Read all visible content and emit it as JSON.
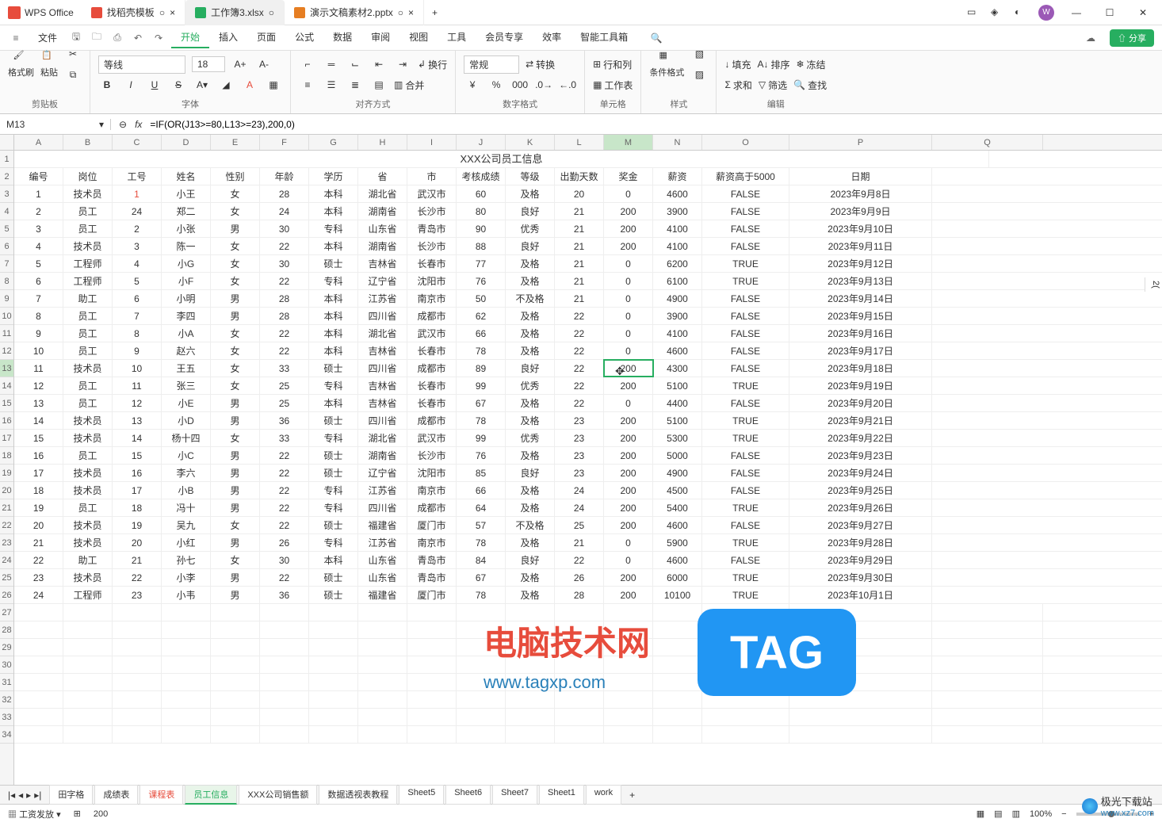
{
  "app": {
    "name": "WPS Office"
  },
  "tabs": [
    {
      "label": "找稻壳模板",
      "icon": "red"
    },
    {
      "label": "工作簿3.xlsx",
      "icon": "green",
      "active": true
    },
    {
      "label": "演示文稿素材2.pptx",
      "icon": "orange"
    }
  ],
  "window_controls": {
    "min": "—",
    "max": "☐",
    "close": "✕"
  },
  "avatar_initial": "W",
  "menubar": {
    "file": "文件",
    "items": [
      "开始",
      "插入",
      "页面",
      "公式",
      "数据",
      "审阅",
      "视图",
      "工具",
      "会员专享",
      "效率",
      "智能工具箱"
    ],
    "active_index": 0,
    "share": "分享"
  },
  "ribbon": {
    "clipboard": {
      "format_painter": "格式刷",
      "paste": "粘贴",
      "label": "剪贴板"
    },
    "font": {
      "name": "等线",
      "size": "18",
      "inc": "A+",
      "dec": "A-",
      "bold": "B",
      "italic": "I",
      "underline": "U",
      "strike": "S",
      "label": "字体"
    },
    "align": {
      "wrap": "换行",
      "merge": "合并",
      "label": "对齐方式"
    },
    "number": {
      "format": "常规",
      "convert": "转换",
      "label": "数字格式"
    },
    "rowcol": {
      "rows": "行和列",
      "sheet": "工作表",
      "label": "单元格"
    },
    "style": {
      "cond": "条件格式",
      "label": "样式"
    },
    "edit": {
      "fill": "填充",
      "sum": "求和",
      "sort": "排序",
      "filter": "筛选",
      "freeze": "冻结",
      "find": "查找",
      "label": "编辑"
    }
  },
  "formula_bar": {
    "cell_ref": "M13",
    "fx": "fx",
    "formula": "=IF(OR(J13>=80,L13>=23),200,0)"
  },
  "columns": [
    "A",
    "B",
    "C",
    "D",
    "E",
    "F",
    "G",
    "H",
    "I",
    "J",
    "K",
    "L",
    "M",
    "N",
    "O",
    "P",
    "Q"
  ],
  "col_widths": [
    "cA",
    "cB",
    "cC",
    "cD",
    "cE",
    "cF",
    "cG",
    "cH",
    "cI",
    "cJ",
    "cK",
    "cL",
    "cM",
    "cN",
    "cO",
    "cP",
    "cQ"
  ],
  "sheet_title": "XXX公司员工信息",
  "headers": [
    "编号",
    "岗位",
    "工号",
    "姓名",
    "性别",
    "年龄",
    "学历",
    "省",
    "市",
    "考核成绩",
    "等级",
    "出勤天数",
    "奖金",
    "薪资",
    "薪资高于5000",
    "日期"
  ],
  "rows": [
    [
      "1",
      "技术员",
      "1",
      "小王",
      "女",
      "28",
      "本科",
      "湖北省",
      "武汉市",
      "60",
      "及格",
      "20",
      "0",
      "4600",
      "FALSE",
      "2023年9月8日"
    ],
    [
      "2",
      "员工",
      "24",
      "郑二",
      "女",
      "24",
      "本科",
      "湖南省",
      "长沙市",
      "80",
      "良好",
      "21",
      "200",
      "3900",
      "FALSE",
      "2023年9月9日"
    ],
    [
      "3",
      "员工",
      "2",
      "小张",
      "男",
      "30",
      "专科",
      "山东省",
      "青岛市",
      "90",
      "优秀",
      "21",
      "200",
      "4100",
      "FALSE",
      "2023年9月10日"
    ],
    [
      "4",
      "技术员",
      "3",
      "陈一",
      "女",
      "22",
      "本科",
      "湖南省",
      "长沙市",
      "88",
      "良好",
      "21",
      "200",
      "4100",
      "FALSE",
      "2023年9月11日"
    ],
    [
      "5",
      "工程师",
      "4",
      "小G",
      "女",
      "30",
      "硕士",
      "吉林省",
      "长春市",
      "77",
      "及格",
      "21",
      "0",
      "6200",
      "TRUE",
      "2023年9月12日"
    ],
    [
      "6",
      "工程师",
      "5",
      "小F",
      "女",
      "22",
      "专科",
      "辽宁省",
      "沈阳市",
      "76",
      "及格",
      "21",
      "0",
      "6100",
      "TRUE",
      "2023年9月13日"
    ],
    [
      "7",
      "助工",
      "6",
      "小明",
      "男",
      "28",
      "本科",
      "江苏省",
      "南京市",
      "50",
      "不及格",
      "21",
      "0",
      "4900",
      "FALSE",
      "2023年9月14日"
    ],
    [
      "8",
      "员工",
      "7",
      "李四",
      "男",
      "28",
      "本科",
      "四川省",
      "成都市",
      "62",
      "及格",
      "22",
      "0",
      "3900",
      "FALSE",
      "2023年9月15日"
    ],
    [
      "9",
      "员工",
      "8",
      "小A",
      "女",
      "22",
      "本科",
      "湖北省",
      "武汉市",
      "66",
      "及格",
      "22",
      "0",
      "4100",
      "FALSE",
      "2023年9月16日"
    ],
    [
      "10",
      "员工",
      "9",
      "赵六",
      "女",
      "22",
      "本科",
      "吉林省",
      "长春市",
      "78",
      "及格",
      "22",
      "0",
      "4600",
      "FALSE",
      "2023年9月17日"
    ],
    [
      "11",
      "技术员",
      "10",
      "王五",
      "女",
      "33",
      "硕士",
      "四川省",
      "成都市",
      "89",
      "良好",
      "22",
      "200",
      "4300",
      "FALSE",
      "2023年9月18日"
    ],
    [
      "12",
      "员工",
      "11",
      "张三",
      "女",
      "25",
      "专科",
      "吉林省",
      "长春市",
      "99",
      "优秀",
      "22",
      "200",
      "5100",
      "TRUE",
      "2023年9月19日"
    ],
    [
      "13",
      "员工",
      "12",
      "小E",
      "男",
      "25",
      "本科",
      "吉林省",
      "长春市",
      "67",
      "及格",
      "22",
      "0",
      "4400",
      "FALSE",
      "2023年9月20日"
    ],
    [
      "14",
      "技术员",
      "13",
      "小D",
      "男",
      "36",
      "硕士",
      "四川省",
      "成都市",
      "78",
      "及格",
      "23",
      "200",
      "5100",
      "TRUE",
      "2023年9月21日"
    ],
    [
      "15",
      "技术员",
      "14",
      "杨十四",
      "女",
      "33",
      "专科",
      "湖北省",
      "武汉市",
      "99",
      "优秀",
      "23",
      "200",
      "5300",
      "TRUE",
      "2023年9月22日"
    ],
    [
      "16",
      "员工",
      "15",
      "小C",
      "男",
      "22",
      "硕士",
      "湖南省",
      "长沙市",
      "76",
      "及格",
      "23",
      "200",
      "5000",
      "FALSE",
      "2023年9月23日"
    ],
    [
      "17",
      "技术员",
      "16",
      "李六",
      "男",
      "22",
      "硕士",
      "辽宁省",
      "沈阳市",
      "85",
      "良好",
      "23",
      "200",
      "4900",
      "FALSE",
      "2023年9月24日"
    ],
    [
      "18",
      "技术员",
      "17",
      "小B",
      "男",
      "22",
      "专科",
      "江苏省",
      "南京市",
      "66",
      "及格",
      "24",
      "200",
      "4500",
      "FALSE",
      "2023年9月25日"
    ],
    [
      "19",
      "员工",
      "18",
      "冯十",
      "男",
      "22",
      "专科",
      "四川省",
      "成都市",
      "64",
      "及格",
      "24",
      "200",
      "5400",
      "TRUE",
      "2023年9月26日"
    ],
    [
      "20",
      "技术员",
      "19",
      "吴九",
      "女",
      "22",
      "硕士",
      "福建省",
      "厦门市",
      "57",
      "不及格",
      "25",
      "200",
      "4600",
      "FALSE",
      "2023年9月27日"
    ],
    [
      "21",
      "技术员",
      "20",
      "小红",
      "男",
      "26",
      "专科",
      "江苏省",
      "南京市",
      "78",
      "及格",
      "21",
      "0",
      "5900",
      "TRUE",
      "2023年9月28日"
    ],
    [
      "22",
      "助工",
      "21",
      "孙七",
      "女",
      "30",
      "本科",
      "山东省",
      "青岛市",
      "84",
      "良好",
      "22",
      "0",
      "4600",
      "FALSE",
      "2023年9月29日"
    ],
    [
      "23",
      "技术员",
      "22",
      "小李",
      "男",
      "22",
      "硕士",
      "山东省",
      "青岛市",
      "67",
      "及格",
      "26",
      "200",
      "6000",
      "TRUE",
      "2023年9月30日"
    ],
    [
      "24",
      "工程师",
      "23",
      "小韦",
      "男",
      "36",
      "硕士",
      "福建省",
      "厦门市",
      "78",
      "及格",
      "28",
      "200",
      "10100",
      "TRUE",
      "2023年10月1日"
    ]
  ],
  "selected": {
    "row_index": 10,
    "col": "M",
    "col_index": 12
  },
  "right_hint": "2(",
  "sheet_tabs": [
    "田字格",
    "成绩表",
    "课程表",
    "员工信息",
    "XXX公司销售额",
    "数据透视表教程",
    "Sheet5",
    "Sheet6",
    "Sheet7",
    "Sheet1",
    "work"
  ],
  "active_sheet": 3,
  "highlight_sheet": 2,
  "status": {
    "left1": "工资发放",
    "left2": "200",
    "zoom": "100%",
    "add": "+"
  },
  "watermarks": {
    "w1": "电脑技术网",
    "w1url": "www.tagxp.com",
    "w2": "TAG",
    "w3": "极光下载站",
    "w3url": "www.xz7.com"
  }
}
